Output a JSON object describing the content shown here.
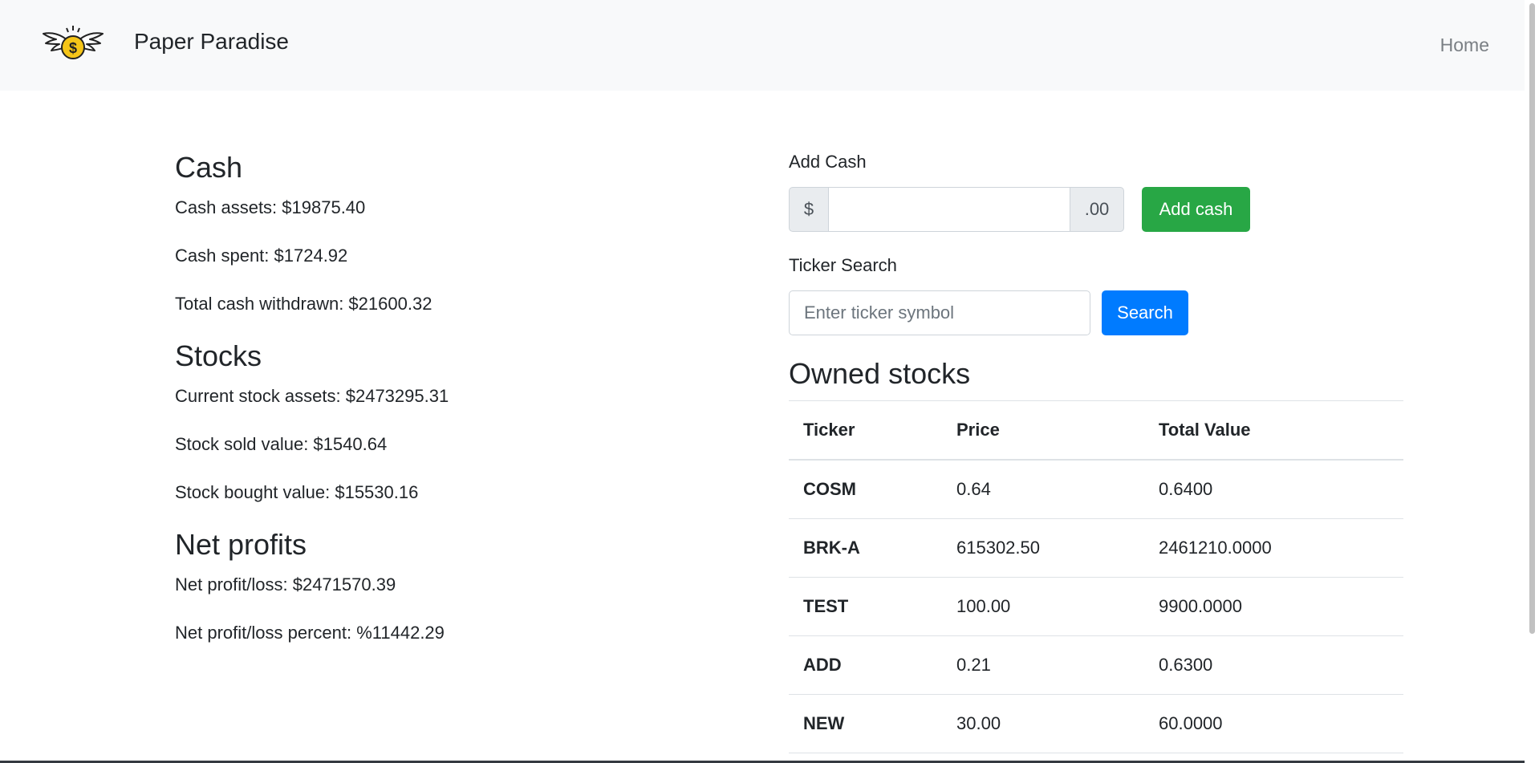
{
  "navbar": {
    "brand_name": "Paper Paradise",
    "home_link": "Home"
  },
  "summary": {
    "cash": {
      "heading": "Cash",
      "cash_assets": "Cash assets: $19875.40",
      "cash_spent": "Cash spent: $1724.92",
      "total_withdrawn": "Total cash withdrawn: $21600.32"
    },
    "stocks": {
      "heading": "Stocks",
      "current_assets": "Current stock assets: $2473295.31",
      "sold_value": "Stock sold value: $1540.64",
      "bought_value": "Stock bought value: $15530.16"
    },
    "net": {
      "heading": "Net profits",
      "profit_loss": "Net profit/loss: $2471570.39",
      "profit_loss_percent": "Net profit/loss percent: %11442.29"
    }
  },
  "add_cash": {
    "label": "Add Cash",
    "prefix": "$",
    "suffix": ".00",
    "value": "",
    "button_label": "Add cash"
  },
  "ticker_search": {
    "label": "Ticker Search",
    "placeholder": "Enter ticker symbol",
    "value": "",
    "button_label": "Search"
  },
  "owned_stocks": {
    "heading": "Owned stocks",
    "columns": [
      "Ticker",
      "Price",
      "Total Value"
    ],
    "rows": [
      {
        "ticker": "COSM",
        "price": "0.64",
        "total": "0.6400"
      },
      {
        "ticker": "BRK-A",
        "price": "615302.50",
        "total": "2461210.0000"
      },
      {
        "ticker": "TEST",
        "price": "100.00",
        "total": "9900.0000"
      },
      {
        "ticker": "ADD",
        "price": "0.21",
        "total": "0.6300"
      },
      {
        "ticker": "NEW",
        "price": "30.00",
        "total": "60.0000"
      }
    ]
  },
  "colors": {
    "navbar_bg": "#f8f9fa",
    "success": "#28a745",
    "primary": "#007bff",
    "logo_coin": "#f5c518"
  },
  "icons": {
    "logo": "winged-dollar-coin-icon"
  }
}
